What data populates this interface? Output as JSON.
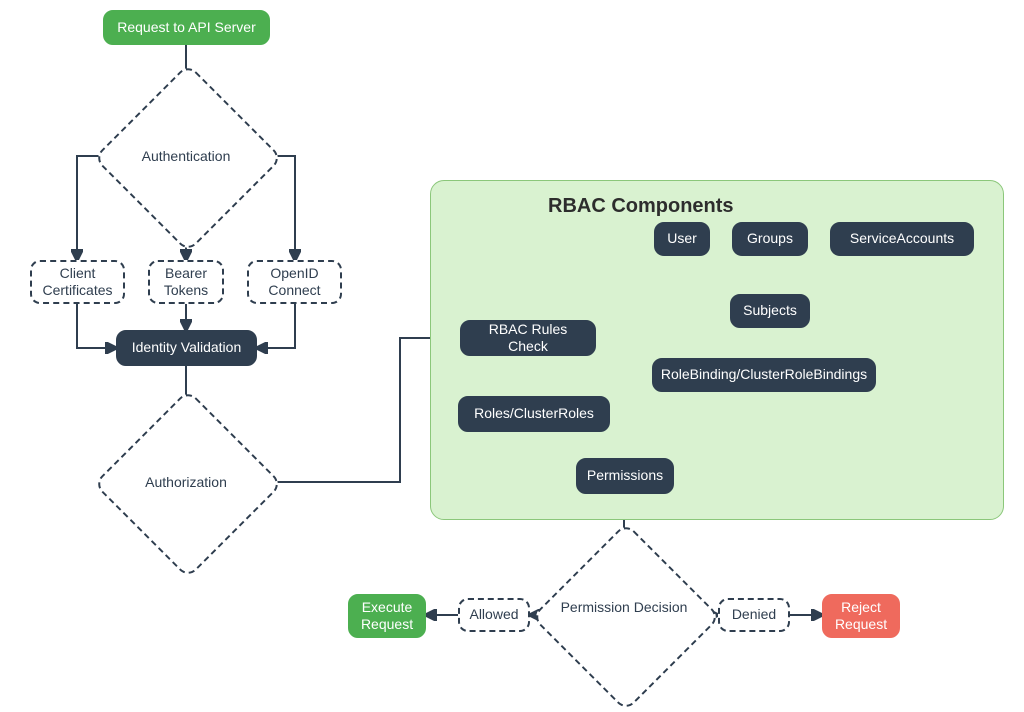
{
  "nodes": {
    "request": "Request to API Server",
    "authentication": "Authentication",
    "client_certs": "Client Certificates",
    "bearer_tokens": "Bearer Tokens",
    "openid_connect": "OpenID Connect",
    "identity": "Identity Validation",
    "authorization": "Authorization",
    "rbac_panel_title": "RBAC Components",
    "rbac_check": "RBAC Rules Check",
    "roles": "Roles/ClusterRoles",
    "permissions": "Permissions",
    "user": "User",
    "groups": "Groups",
    "service_accounts": "ServiceAccounts",
    "subjects": "Subjects",
    "rolebindings": "RoleBinding/ClusterRoleBindings",
    "perm_decision": "Permission Decision",
    "allowed": "Allowed",
    "denied": "Denied",
    "execute": "Execute Request",
    "reject": "Reject Request"
  }
}
